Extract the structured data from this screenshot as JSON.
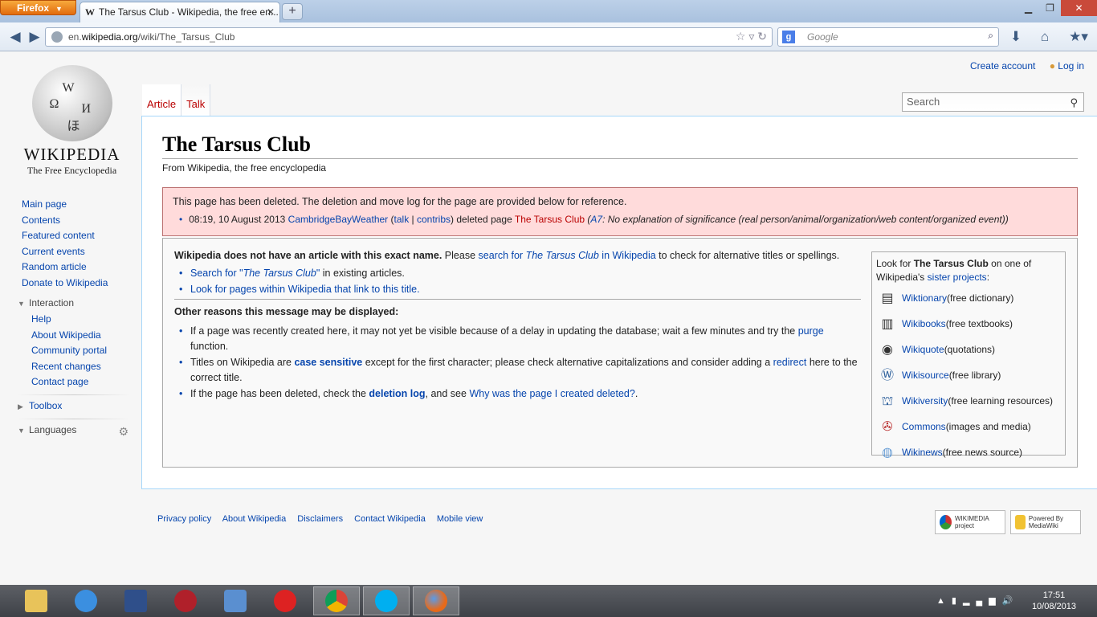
{
  "browser": {
    "menu_button": "Firefox",
    "tab_title": "The Tarsus Club - Wikipedia, the free en...",
    "tab_favicon": "W",
    "url_prefix": "en.",
    "url_host": "wikipedia.org",
    "url_path": "/wiki/The_Tarsus_Club",
    "search_engine_placeholder": "Google"
  },
  "personal": {
    "create_account": "Create account",
    "log_in": "Log in"
  },
  "logo": {
    "wordmark": "WIKIPEDIA",
    "tagline": "The Free Encyclopedia"
  },
  "sidebar": {
    "navigation": [
      "Main page",
      "Contents",
      "Featured content",
      "Current events",
      "Random article",
      "Donate to Wikipedia"
    ],
    "interaction_label": "Interaction",
    "interaction": [
      "Help",
      "About Wikipedia",
      "Community portal",
      "Recent changes",
      "Contact page"
    ],
    "toolbox_label": "Toolbox",
    "languages_label": "Languages"
  },
  "tabs": {
    "article": "Article",
    "talk": "Talk"
  },
  "search": {
    "placeholder": "Search"
  },
  "article": {
    "title": "The Tarsus Club",
    "subtitle": "From Wikipedia, the free encyclopedia"
  },
  "deletion": {
    "notice": "This page has been deleted. The deletion and move log for the page are provided below for reference.",
    "log_time": "08:19, 10 August 2013",
    "log_user": "CambridgeBayWeather",
    "log_talk": "talk",
    "log_sep": " | ",
    "log_contribs": "contribs",
    "log_action": " deleted page ",
    "log_page": "The Tarsus Club",
    "log_reason_code": "A7",
    "log_reason": ": No explanation of significance (real person/animal/organization/web content/organized event)"
  },
  "noarticle": {
    "lead_bold": "Wikipedia does not have an article with this exact name.",
    "lead_text1": " Please ",
    "lead_link1": "search for ",
    "lead_link1_i": "The Tarsus Club",
    "lead_link1_end": " in Wikipedia",
    "lead_text2": " to check for alternative titles or spellings.",
    "bullet1_link": "Search for \"",
    "bullet1_link_i": "The Tarsus Club",
    "bullet1_link_end": "\"",
    "bullet1_text": " in existing articles.",
    "bullet2_link": "Look for pages within Wikipedia that link to this title.",
    "other_reasons": "Other reasons this message may be displayed:",
    "reason1_text": "If a page was recently created here, it may not yet be visible because of a delay in updating the database; wait a few minutes and try the ",
    "reason1_link": "purge",
    "reason1_end": " function.",
    "reason2_text1": "Titles on Wikipedia are ",
    "reason2_link1": "case sensitive",
    "reason2_text2": " except for the first character; please check alternative capitalizations and consider adding a ",
    "reason2_link2": "redirect",
    "reason2_text3": " here to the correct title.",
    "reason3_text1": "If the page has been deleted, check the ",
    "reason3_link1": "deletion log",
    "reason3_text2": ", and see ",
    "reason3_link2": "Why was the page I created deleted?",
    "reason3_text3": "."
  },
  "sister": {
    "intro1": "Look for ",
    "intro_bold": "The Tarsus Club",
    "intro2": " on one of Wikipedia's ",
    "intro_link": "sister projects",
    "intro_end": ":",
    "projects": [
      {
        "name": "Wiktionary",
        "desc": " (free dictionary)",
        "icon": "wiktionary-icon"
      },
      {
        "name": "Wikibooks",
        "desc": " (free textbooks)",
        "icon": "wikibooks-icon"
      },
      {
        "name": "Wikiquote",
        "desc": " (quotations)",
        "icon": "wikiquote-icon"
      },
      {
        "name": "Wikisource",
        "desc": " (free library)",
        "icon": "wikisource-icon"
      },
      {
        "name": "Wikiversity",
        "desc": " (free learning resources)",
        "icon": "wikiversity-icon"
      },
      {
        "name": "Commons",
        "desc": " (images and media)",
        "icon": "commons-icon"
      },
      {
        "name": "Wikinews",
        "desc": " (free news source)",
        "icon": "wikinews-icon"
      }
    ]
  },
  "footer": {
    "links": [
      "Privacy policy",
      "About Wikipedia",
      "Disclaimers",
      "Contact Wikipedia",
      "Mobile view"
    ],
    "wikimedia_badge": "WIKIMEDIA project",
    "mediawiki_badge": "Powered By MediaWiki"
  },
  "taskbar": {
    "time": "17:51",
    "date": "10/08/2013"
  }
}
